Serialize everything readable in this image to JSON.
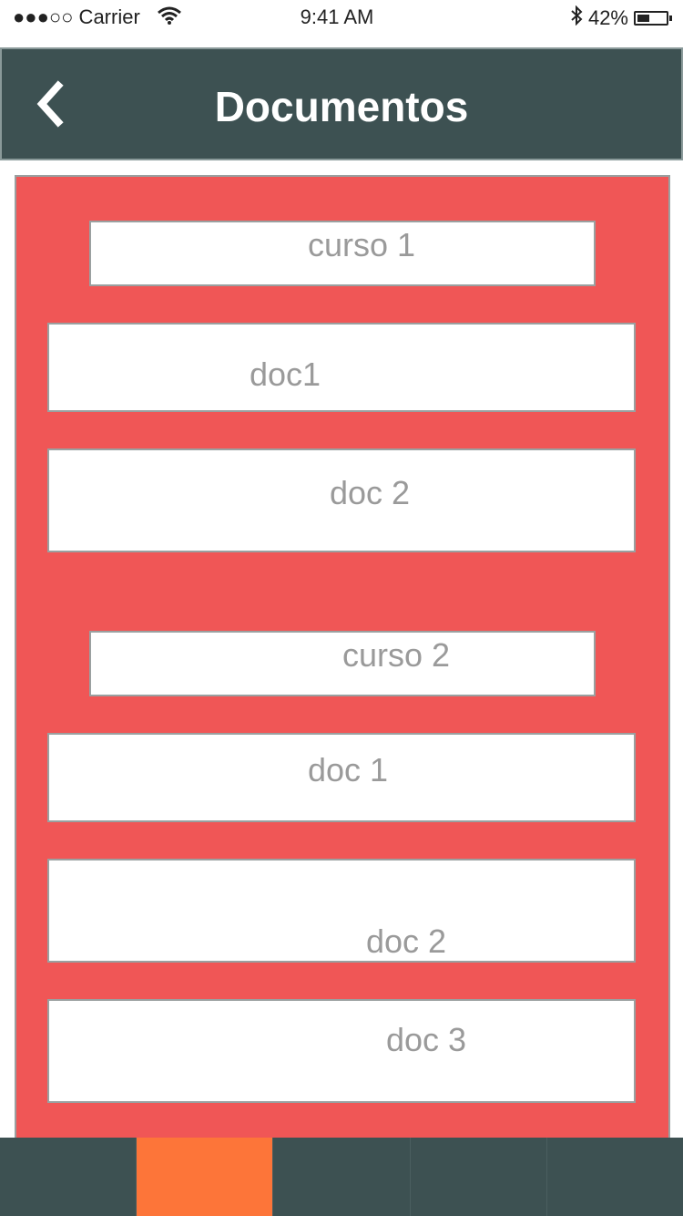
{
  "status_bar": {
    "carrier": "●●●○○ Carrier",
    "time": "9:41 AM",
    "battery": "42%",
    "battery_level": 0.42
  },
  "header": {
    "title": "Documentos",
    "back_icon": "chevron-left-icon"
  },
  "sections": [
    {
      "course": "curso 1",
      "docs": [
        "doc1",
        "doc 2"
      ]
    },
    {
      "course": "curso 2",
      "docs": [
        "doc 1",
        "doc 2",
        "doc 3"
      ]
    }
  ],
  "tab_bar": {
    "tab_count": 5,
    "active_index": 1
  },
  "colors": {
    "header_bg": "#3d5152",
    "panel_bg": "#f05656",
    "active_tab": "#fd7539",
    "inactive_tab": "#3d5152",
    "item_text": "#9a9a9a"
  }
}
